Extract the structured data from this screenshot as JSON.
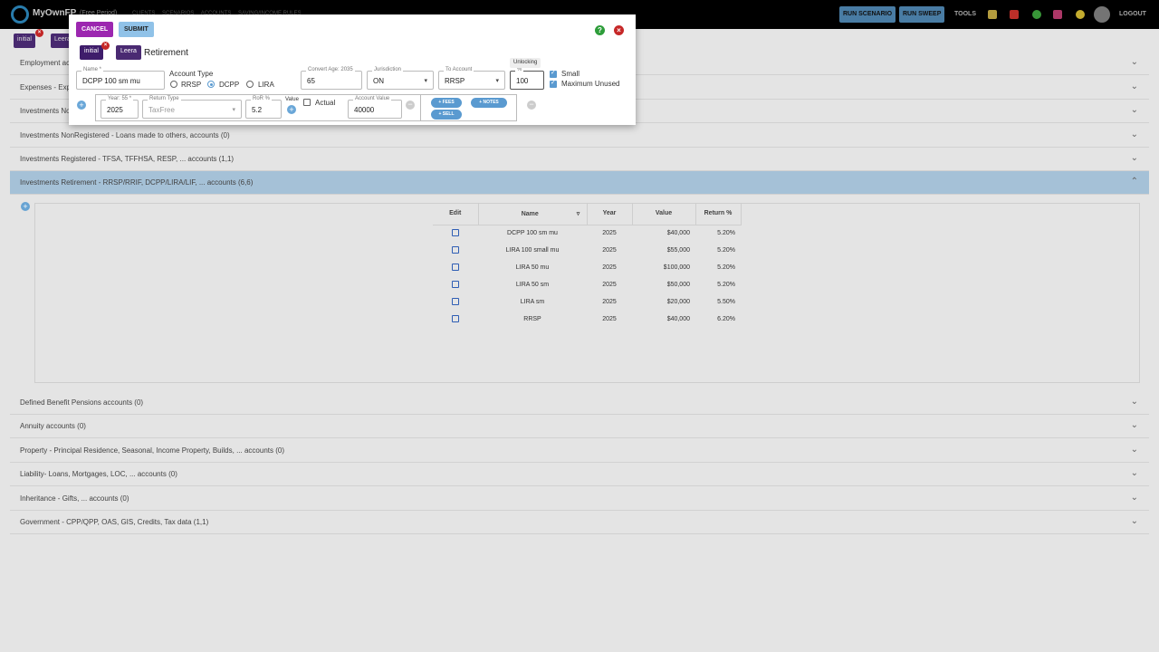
{
  "header": {
    "brand": "MyOwnFP",
    "brand_sub": "(Free Period)",
    "nav": [
      "CLIENTS",
      "SCENARIOS",
      "ACCOUNTS",
      "SAVING/INCOME RULES"
    ],
    "run_scenario": "RUN SCENARIO",
    "run_sweep": "RUN SWEEP",
    "tools": "TOOLS",
    "logout": "LOGOUT"
  },
  "scenario_tags": [
    "initial",
    "Leera"
  ],
  "accordion": [
    {
      "label": "Employment accounts"
    },
    {
      "label": "Expenses - Expenses accounts"
    },
    {
      "label": "Investments NonRegistered accounts"
    },
    {
      "label": "Investments NonRegistered - Loans made to others, accounts (0)"
    },
    {
      "label": "Investments Registered - TFSA, TFFHSA, RESP, ... accounts (1,1)"
    },
    {
      "label": "Investments Retirement - RRSP/RRIF, DCPP/LIRA/LIF, ... accounts (6,6)"
    },
    {
      "label": "Defined Benefit Pensions accounts (0)"
    },
    {
      "label": "Annuity accounts (0)"
    },
    {
      "label": "Property - Principal Residence, Seasonal, Income Property, Builds, ... accounts (0)"
    },
    {
      "label": "Liability- Loans, Mortgages, LOC, ... accounts (0)"
    },
    {
      "label": "Inheritance - Gifts, ... accounts (0)"
    },
    {
      "label": "Government - CPP/QPP, OAS, GIS, Credits, Tax data (1,1)"
    }
  ],
  "table": {
    "headers": [
      "Edit",
      "Name",
      "Year",
      "Value",
      "Return %"
    ],
    "rows": [
      {
        "name": "DCPP 100 sm mu",
        "year": "2025",
        "value": "$40,000",
        "ret": "5.20%"
      },
      {
        "name": "LIRA 100 small mu",
        "year": "2025",
        "value": "$55,000",
        "ret": "5.20%"
      },
      {
        "name": "LIRA 50 mu",
        "year": "2025",
        "value": "$100,000",
        "ret": "5.20%"
      },
      {
        "name": "LIRA 50 sm",
        "year": "2025",
        "value": "$50,000",
        "ret": "5.20%"
      },
      {
        "name": "LIRA sm",
        "year": "2025",
        "value": "$20,000",
        "ret": "5.50%"
      },
      {
        "name": "RRSP",
        "year": "2025",
        "value": "$40,000",
        "ret": "6.20%"
      }
    ]
  },
  "modal": {
    "cancel": "CANCEL",
    "submit": "SUBMIT",
    "tags": [
      "initial",
      "Leera"
    ],
    "title": "Retirement",
    "name_label": "Name *",
    "name_value": "DCPP 100 sm mu",
    "account_type_label": "Account Type",
    "account_types": [
      "RRSP",
      "DCPP",
      "LIRA"
    ],
    "convert_label": "Convert Age: 2035",
    "convert_value": "65",
    "jurisdiction_label": "Jurisdiction",
    "jurisdiction_value": "ON",
    "to_account_label": "To Account",
    "to_account_value": "RRSP",
    "pct_label": "%",
    "pct_value": "100",
    "tooltip": "Unlocking",
    "small_label": "Small",
    "max_unused_label": "Maximum Unused",
    "year_label": "Year: 55 *",
    "year_value": "2025",
    "return_type_label": "Return Type",
    "return_type_value": "TaxFree",
    "ror_label": "RoR %",
    "ror_value": "5.2",
    "value_label": "Value",
    "actual_label": "Actual",
    "account_value_label": "Account Value",
    "account_value": "40000",
    "fees": "+ FEES",
    "notes": "+ NOTES",
    "sell": "+ SELL"
  }
}
